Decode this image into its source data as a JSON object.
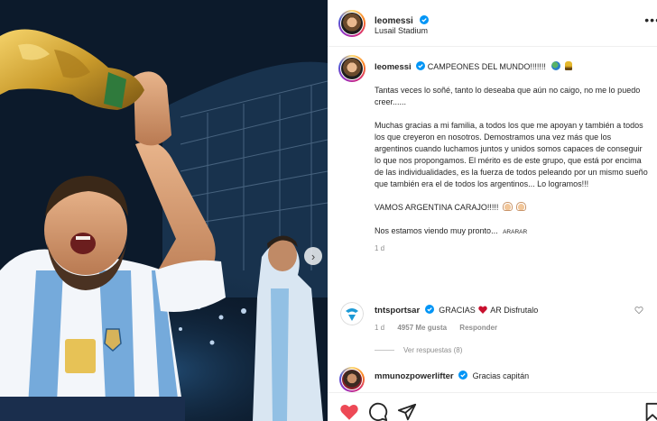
{
  "post": {
    "username": "leomessi",
    "location": "Lusail Stadium",
    "caption_head": "CAMPEONES DEL MUNDO!!!!!!!",
    "paragraphs": [
      "Tantas veces lo soñé, tanto lo deseaba que aún no caigo, no me lo puedo creer......",
      "Muchas gracias a mi familia, a todos los que me apoyan y también a todos los que creyeron en nosotros. Demostramos una vez más que los argentinos cuando luchamos juntos y unidos somos capaces de conseguir lo que nos propongamos. El mérito es de este grupo, que está por encima de las individualidades, es la fuerza de todos peleando por un mismo sueño que también era el de todos los argentinos... Lo logramos!!!",
      "VAMOS ARGENTINA CARAJO!!!!!",
      "Nos estamos viendo muy pronto..."
    ],
    "caption_tail_tag": "ARARAR",
    "age": "1 d"
  },
  "comments": [
    {
      "username": "tntsportsar",
      "text_before": "GRACIAS",
      "text_after": "AR Disfrutalo",
      "age": "1 d",
      "likes": "4957 Me gusta",
      "reply_label": "Responder",
      "view_replies": "Ver respuestas (8)"
    },
    {
      "username": "mmunozpowerlifter",
      "text": "Gracias capitán"
    }
  ],
  "icons": {
    "verified": "verified-badge-icon",
    "more": "more-options-icon",
    "next": "chevron-right-icon",
    "like": "heart-icon",
    "comment": "comment-icon",
    "share": "send-icon",
    "save": "bookmark-icon"
  },
  "colors": {
    "verified": "#0095f6",
    "like_red": "#ed4956",
    "text": "#262626",
    "muted": "#8e8e8e"
  }
}
